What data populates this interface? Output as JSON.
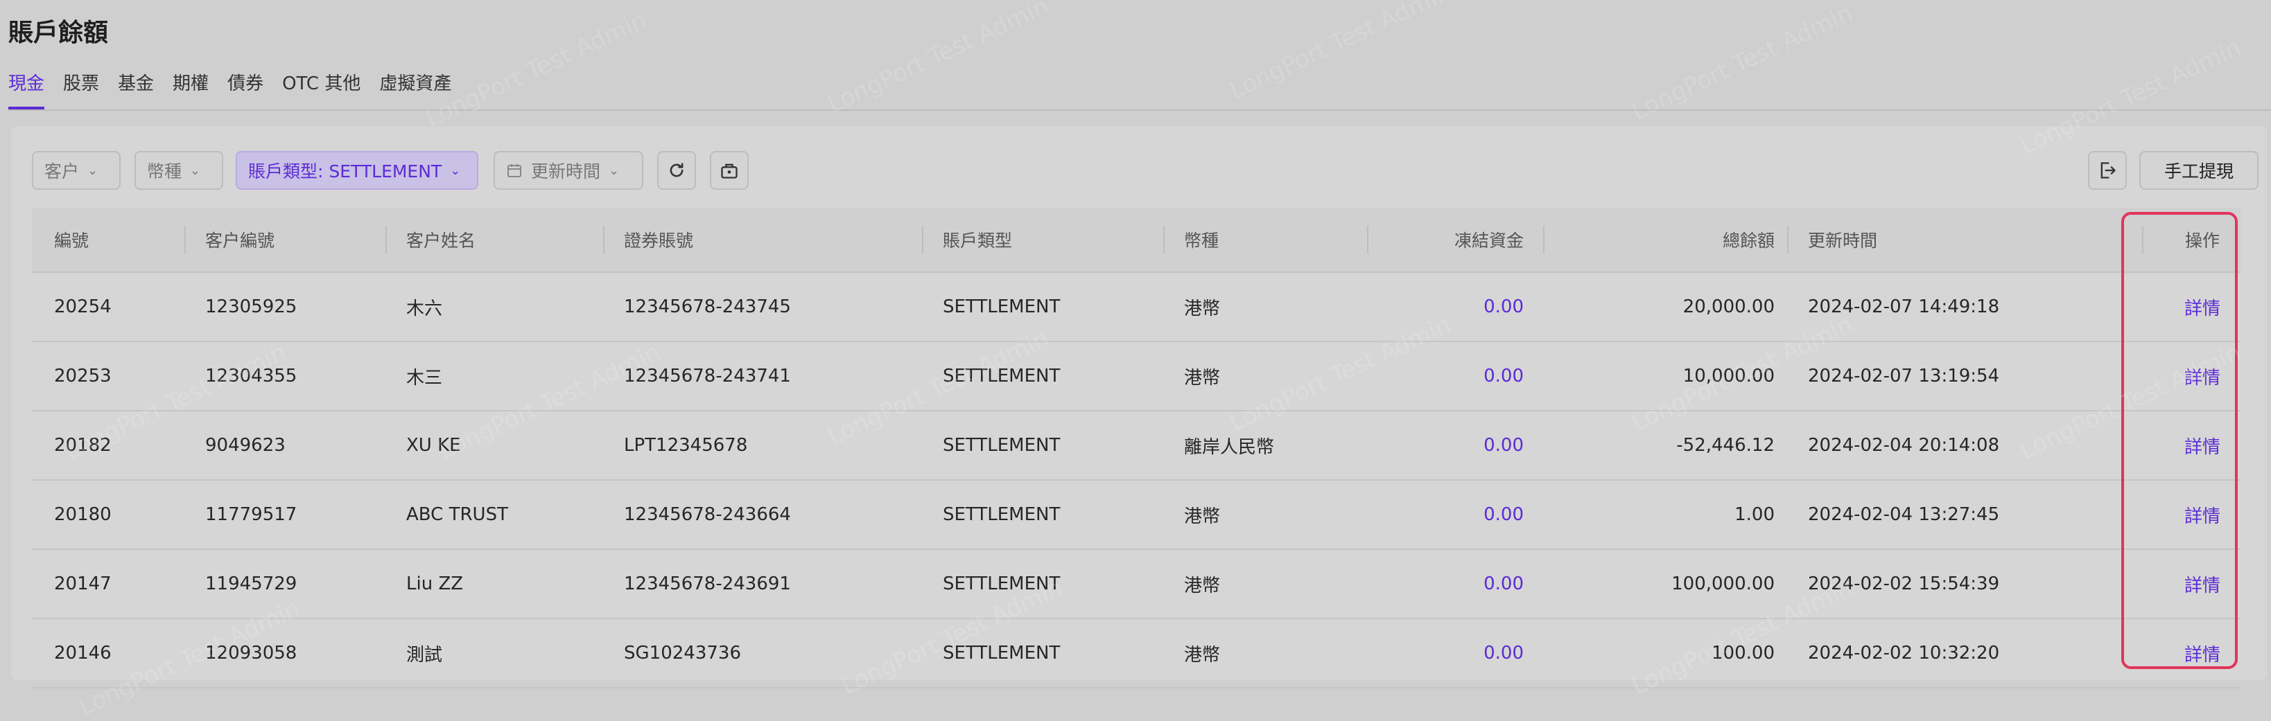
{
  "page": {
    "title": "賬戶餘額"
  },
  "tabs": [
    {
      "label": "現金",
      "active": true
    },
    {
      "label": "股票",
      "active": false
    },
    {
      "label": "基金",
      "active": false
    },
    {
      "label": "期權",
      "active": false
    },
    {
      "label": "債券",
      "active": false
    },
    {
      "label": "OTC 其他",
      "active": false
    },
    {
      "label": "虛擬資產",
      "active": false
    }
  ],
  "filters": {
    "customer": "客户",
    "currency": "幣種",
    "account_type": "賬戶類型: SETTLEMENT",
    "update_time": "更新時間"
  },
  "toolbar": {
    "refresh_icon": "refresh-icon",
    "lock_icon": "briefcase-lock-icon",
    "export_icon": "export-icon",
    "manual_withdraw_label": "手工提現"
  },
  "table": {
    "columns": [
      "編號",
      "客户編號",
      "客户姓名",
      "證券賬號",
      "賬戶類型",
      "幣種",
      "凍結資金",
      "總餘額",
      "更新時間",
      "操作"
    ],
    "rows": [
      {
        "id": "20254",
        "customer_no": "12305925",
        "name": "木六",
        "account": "12345678-243745",
        "type": "SETTLEMENT",
        "currency": "港幣",
        "frozen": "0.00",
        "total": "20,000.00",
        "updated": "2024-02-07 14:49:18",
        "action": "詳情"
      },
      {
        "id": "20253",
        "customer_no": "12304355",
        "name": "木三",
        "account": "12345678-243741",
        "type": "SETTLEMENT",
        "currency": "港幣",
        "frozen": "0.00",
        "total": "10,000.00",
        "updated": "2024-02-07 13:19:54",
        "action": "詳情"
      },
      {
        "id": "20182",
        "customer_no": "9049623",
        "name": "XU KE",
        "account": "LPT12345678",
        "type": "SETTLEMENT",
        "currency": "離岸人民幣",
        "frozen": "0.00",
        "total": "-52,446.12",
        "updated": "2024-02-04 20:14:08",
        "action": "詳情"
      },
      {
        "id": "20180",
        "customer_no": "11779517",
        "name": "ABC TRUST",
        "account": "12345678-243664",
        "type": "SETTLEMENT",
        "currency": "港幣",
        "frozen": "0.00",
        "total": "1.00",
        "updated": "2024-02-04 13:27:45",
        "action": "詳情"
      },
      {
        "id": "20147",
        "customer_no": "11945729",
        "name": "Liu ZZ",
        "account": "12345678-243691",
        "type": "SETTLEMENT",
        "currency": "港幣",
        "frozen": "0.00",
        "total": "100,000.00",
        "updated": "2024-02-02 15:54:39",
        "action": "詳情"
      },
      {
        "id": "20146",
        "customer_no": "12093058",
        "name": "測試",
        "account": "SG10243736",
        "type": "SETTLEMENT",
        "currency": "港幣",
        "frozen": "0.00",
        "total": "100.00",
        "updated": "2024-02-02 10:32:20",
        "action": "詳情"
      }
    ]
  },
  "watermark": "LongPort Test Admin",
  "colors": {
    "accent": "#5b2bd6",
    "highlight": "#e0355c",
    "overlay": "#cfcfcf"
  }
}
